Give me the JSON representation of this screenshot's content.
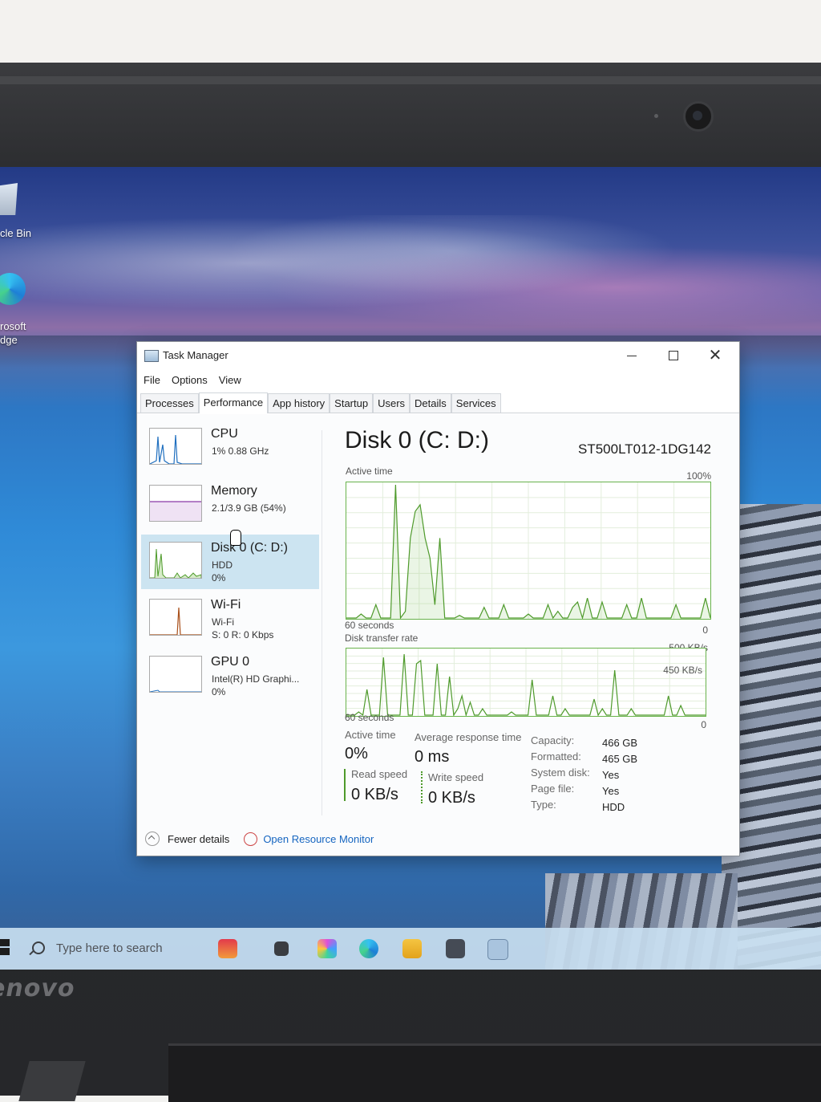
{
  "desktop": {
    "icons": [
      {
        "label_line1": "cle Bin",
        "label_line2": ""
      },
      {
        "label_line1": "rosoft",
        "label_line2": "dge"
      }
    ]
  },
  "brand_text": "enovo",
  "taskbar": {
    "search_placeholder": "Type here to search"
  },
  "task_manager": {
    "title": "Task Manager",
    "menu": [
      "File",
      "Options",
      "View"
    ],
    "tabs": [
      "Processes",
      "Performance",
      "App history",
      "Startup",
      "Users",
      "Details",
      "Services"
    ],
    "active_tab": "Performance",
    "resources": [
      {
        "name": "CPU",
        "sub1": "1% 0.88 GHz",
        "sub2": "",
        "color": "#1f6fbf"
      },
      {
        "name": "Memory",
        "sub1": "2.1/3.9 GB (54%)",
        "sub2": "",
        "color": "#8b3aa8"
      },
      {
        "name": "Disk 0 (C: D:)",
        "sub1": "HDD",
        "sub2": "0%",
        "color": "#4e9a2b"
      },
      {
        "name": "Wi-Fi",
        "sub1": "Wi-Fi",
        "sub2": "S: 0 R: 0 Kbps",
        "color": "#a9501b"
      },
      {
        "name": "GPU 0",
        "sub1": "Intel(R) HD Graphi...",
        "sub2": "0%",
        "color": "#1f6fbf"
      }
    ],
    "selected_resource": "Disk 0 (C: D:)",
    "detail": {
      "title": "Disk 0 (C: D:)",
      "model": "ST500LT012-1DG142",
      "active_time_label": "Active time",
      "active_time_max": "100%",
      "active_time_window": "60 seconds",
      "active_time_min": "0",
      "transfer_label": "Disk transfer rate",
      "transfer_max": "500 KB/s",
      "transfer_mid": "450 KB/s",
      "transfer_window": "60 seconds",
      "transfer_min": "0",
      "active_time_series": [
        0,
        0,
        0,
        3,
        0,
        0,
        10,
        0,
        0,
        0,
        100,
        0,
        5,
        60,
        80,
        85,
        60,
        45,
        10,
        60,
        0,
        0,
        0,
        2,
        0,
        0,
        0,
        0,
        8,
        0,
        0,
        0,
        10,
        0,
        0,
        0,
        0,
        3,
        0,
        0,
        0,
        10,
        0,
        5,
        0,
        0,
        8,
        12,
        0,
        15,
        0,
        0,
        12,
        0,
        0,
        0,
        0,
        10,
        0,
        0,
        15,
        0,
        0,
        0,
        0,
        0,
        0,
        10,
        0,
        0,
        0,
        0,
        0,
        15,
        0
      ],
      "transfer_series": [
        0,
        0,
        0,
        5,
        0,
        40,
        0,
        0,
        0,
        90,
        0,
        0,
        0,
        0,
        95,
        0,
        0,
        80,
        85,
        0,
        0,
        0,
        80,
        0,
        0,
        60,
        0,
        10,
        30,
        0,
        20,
        0,
        0,
        10,
        0,
        0,
        0,
        0,
        0,
        0,
        5,
        0,
        0,
        0,
        0,
        55,
        0,
        0,
        0,
        0,
        30,
        0,
        0,
        10,
        0,
        0,
        0,
        0,
        0,
        0,
        25,
        0,
        10,
        0,
        0,
        70,
        0,
        0,
        0,
        10,
        0,
        0,
        0,
        0,
        0,
        0,
        0,
        0,
        30,
        0,
        0,
        15,
        0,
        0,
        0,
        0,
        0,
        0
      ],
      "stats": {
        "active_time": {
          "label": "Active time",
          "value": "0%"
        },
        "avg_response": {
          "label": "Average response time",
          "value": "0 ms"
        },
        "read_speed": {
          "label": "Read speed",
          "value": "0 KB/s"
        },
        "write_speed": {
          "label": "Write speed",
          "value": "0 KB/s"
        }
      },
      "properties": [
        {
          "key": "Capacity:",
          "value": "466 GB"
        },
        {
          "key": "Formatted:",
          "value": "465 GB"
        },
        {
          "key": "System disk:",
          "value": "Yes"
        },
        {
          "key": "Page file:",
          "value": "Yes"
        },
        {
          "key": "Type:",
          "value": "HDD"
        }
      ]
    },
    "footer": {
      "fewer_details": "Fewer details",
      "open_resource_monitor": "Open Resource Monitor"
    }
  }
}
